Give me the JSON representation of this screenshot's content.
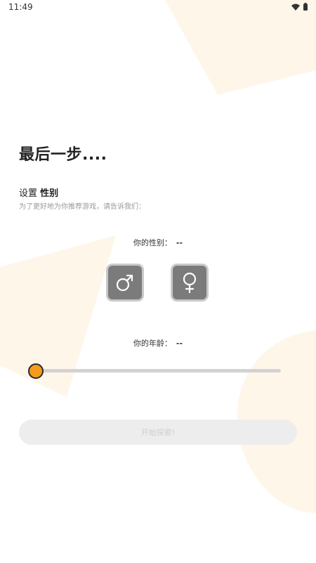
{
  "status_bar": {
    "time": "11:49"
  },
  "title": "最后一步....",
  "section": {
    "heading_prefix": "设置",
    "heading_emphasis": "性别",
    "subtitle": "为了更好地为你推荐游戏，请告诉我们："
  },
  "gender": {
    "label": "你的性别：",
    "value": "--",
    "options": [
      "male",
      "female"
    ]
  },
  "age": {
    "label": "你的年龄：",
    "value": "--",
    "slider_fraction": 0.0
  },
  "start_button": {
    "label": "开始探索!"
  },
  "colors": {
    "accent": "#f59b1e",
    "background_shape": "#fff6ea",
    "button_gray": "#7b7b7b"
  },
  "icons": [
    "wifi-icon",
    "battery-icon",
    "male-icon",
    "female-icon"
  ]
}
